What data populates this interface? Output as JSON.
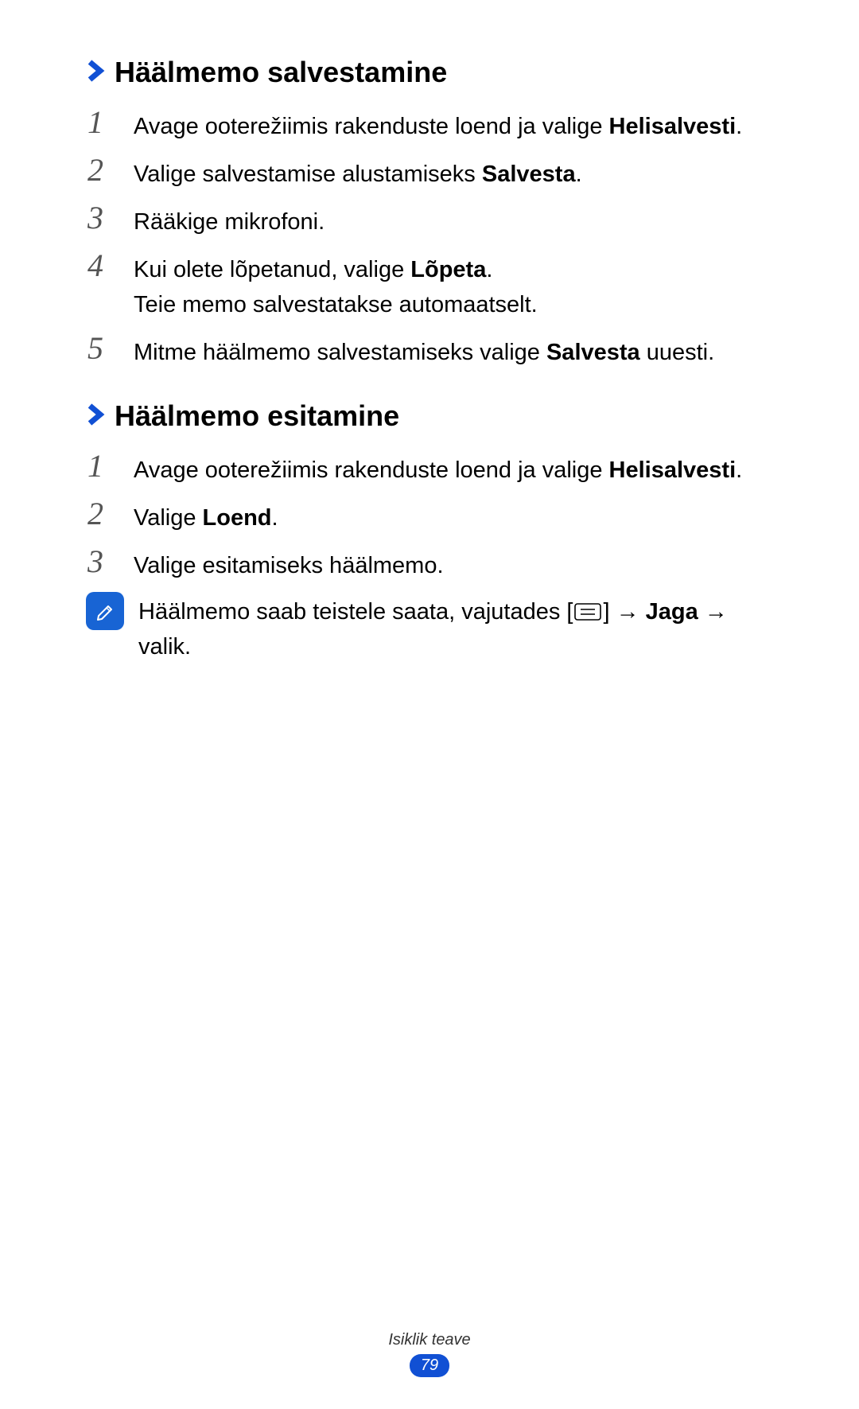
{
  "section1": {
    "heading": "Häälmemo salvestamine",
    "steps": [
      {
        "num": "1",
        "pre": "Avage ooterežiimis rakenduste loend ja valige ",
        "bold": "Helisalvesti",
        "post": "."
      },
      {
        "num": "2",
        "pre": "Valige salvestamise alustamiseks ",
        "bold": "Salvesta",
        "post": "."
      },
      {
        "num": "3",
        "pre": "Rääkige mikrofoni.",
        "bold": "",
        "post": ""
      },
      {
        "num": "4",
        "pre": "Kui olete lõpetanud, valige ",
        "bold": "Lõpeta",
        "post": ".",
        "sub": "Teie memo salvestatakse automaatselt."
      },
      {
        "num": "5",
        "pre": "Mitme häälmemo salvestamiseks valige ",
        "bold": "Salvesta",
        "post": " uuesti."
      }
    ]
  },
  "section2": {
    "heading": "Häälmemo esitamine",
    "steps": [
      {
        "num": "1",
        "pre": "Avage ooterežiimis rakenduste loend ja valige ",
        "bold": "Helisalvesti",
        "post": "."
      },
      {
        "num": "2",
        "pre": "Valige ",
        "bold": "Loend",
        "post": "."
      },
      {
        "num": "3",
        "pre": "Valige esitamiseks häälmemo.",
        "bold": "",
        "post": ""
      }
    ],
    "note": {
      "pre": "Häälmemo saab teistele saata, vajutades [",
      "mid": "] → ",
      "bold": "Jaga",
      "post1": " →",
      "post2": "valik."
    }
  },
  "footer": {
    "section_label": "Isiklik teave",
    "page": "79"
  }
}
